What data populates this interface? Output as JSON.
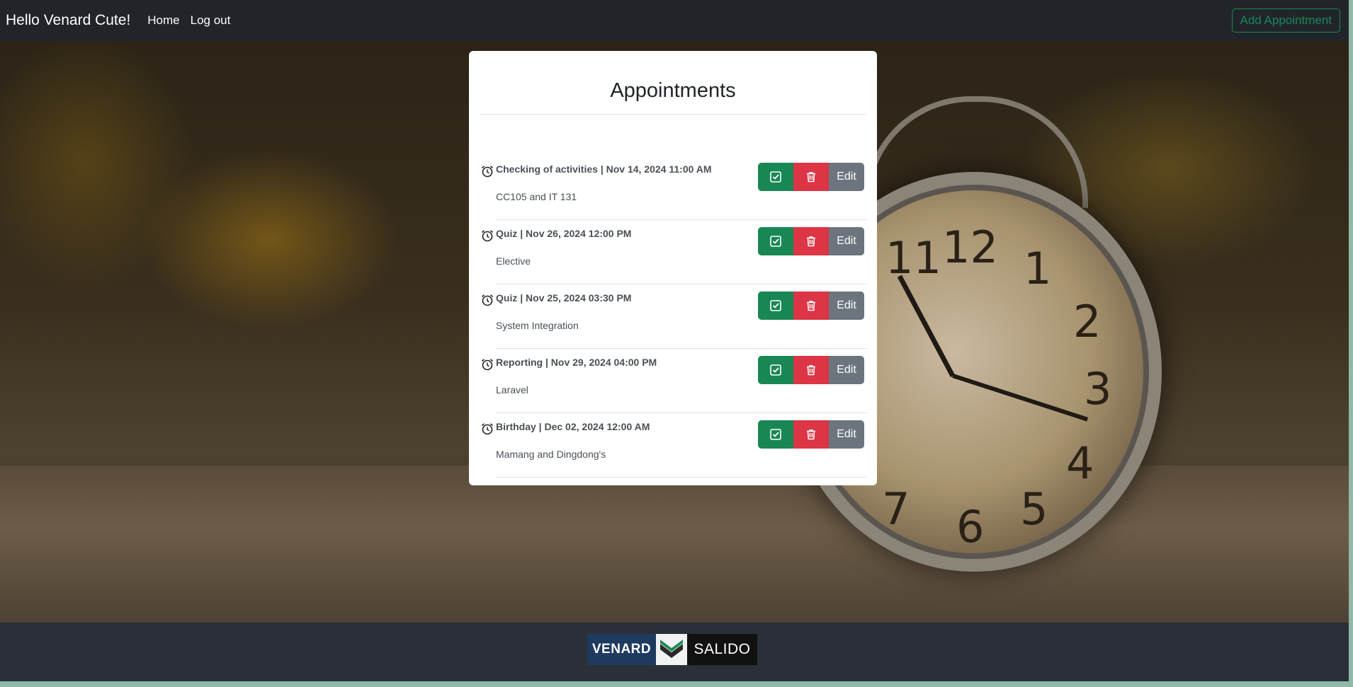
{
  "navbar": {
    "brand": "Hello Venard Cute!",
    "links": [
      "Home",
      "Log out"
    ],
    "add_button": "Add Appointment"
  },
  "card": {
    "title": "Appointments",
    "items": [
      {
        "heading": "Checking of activities | Nov 14, 2024 11:00 AM",
        "desc": "CC105 and IT 131"
      },
      {
        "heading": "Quiz | Nov 26, 2024 12:00 PM",
        "desc": "Elective"
      },
      {
        "heading": "Quiz | Nov 25, 2024 03:30 PM",
        "desc": "System Integration"
      },
      {
        "heading": "Reporting | Nov 29, 2024 04:00 PM",
        "desc": "Laravel"
      },
      {
        "heading": "Birthday | Dec 02, 2024 12:00 AM",
        "desc": "Mamang and Dingdong's"
      }
    ],
    "edit_label": "Edit"
  },
  "footer": {
    "logo_left": "VENARD",
    "logo_right": "SALIDO"
  },
  "colors": {
    "navbar": "#212529",
    "success": "#198754",
    "danger": "#dc3545",
    "secondary": "#6c757d",
    "footer": "#2b3038"
  },
  "icons": {
    "item": "alarm-clock-icon",
    "done": "check-square-icon",
    "delete": "trash-icon"
  }
}
